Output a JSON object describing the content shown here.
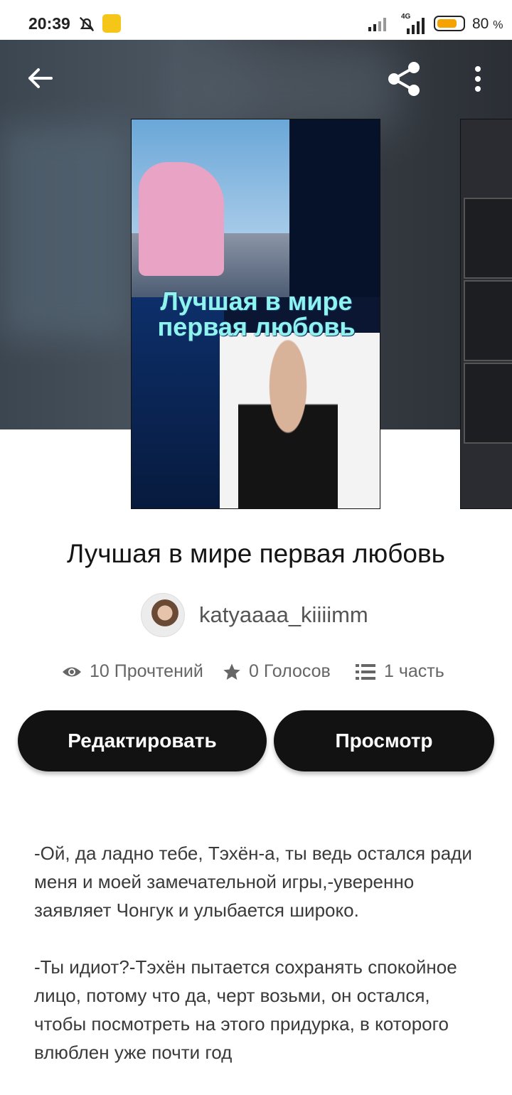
{
  "status_bar": {
    "time": "20:39",
    "network": "4G",
    "battery_percent": "80",
    "battery_unit": "%",
    "battery_level": 0.8
  },
  "toolbar": {
    "back_icon": "arrow-left-icon",
    "share_icon": "share-icon",
    "menu_icon": "more-vert-icon"
  },
  "cover": {
    "title_line1": "Лучшая в мире",
    "title_line2": "первая любовь"
  },
  "book": {
    "title": "Лучшая в мире первая любовь",
    "author": "katyaaaa_kiiiimm"
  },
  "stats": {
    "reads": "10 Прочтений",
    "votes": "0 Голосов",
    "parts": "1 часть"
  },
  "actions": {
    "edit_label": "Редактировать",
    "view_label": "Просмотр"
  },
  "story": {
    "paragraphs": [
      "-Ой, да ладно тебе, Тэхён-а, ты ведь остался ради меня и моей замечательной игры,-уверенно заявляет Чонгук и улыбается широко.",
      "-Ты идиот?-Тэхён пытается сохранять спокойное лицо, потому что да, черт возьми, он остался, чтобы посмотреть на этого придурка, в которого влюблен уже почти год"
    ]
  },
  "colors": {
    "button_bg": "#121212",
    "battery_fill": "#f5a300",
    "cover_title": "#8ff3ee"
  }
}
